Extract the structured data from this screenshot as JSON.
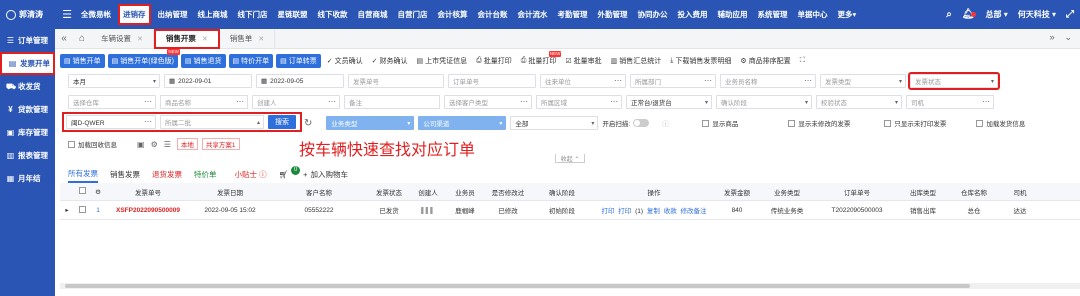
{
  "topbar": {
    "brand": "郭清涛",
    "nav": [
      "全微易帐",
      "进销存",
      "出纳管理",
      "线上商城",
      "线下门店",
      "星链联盟",
      "线下收款",
      "自营商城",
      "自营门店",
      "会计核算",
      "会计台账",
      "会计流水",
      "考勤管理",
      "外勤管理",
      "协同办公",
      "投入费用",
      "辅助应用",
      "系统管理",
      "单据中心",
      "更多"
    ],
    "active_nav": "进销存",
    "user_org": "总部",
    "user_company": "何天科技"
  },
  "sidebar": {
    "items": [
      {
        "label": "订单管理",
        "icon": "list-icon"
      },
      {
        "label": "发票开单",
        "icon": "doc-icon",
        "active": true
      },
      {
        "label": "收发货",
        "icon": "truck-icon"
      },
      {
        "label": "贷款管理",
        "icon": "money-icon"
      },
      {
        "label": "库存管理",
        "icon": "box-icon"
      },
      {
        "label": "报表管理",
        "icon": "report-icon"
      },
      {
        "label": "月年结",
        "icon": "calendar-icon"
      }
    ]
  },
  "tabstrip": {
    "tabs": [
      {
        "label": "车辆设置",
        "active": false
      },
      {
        "label": "销售开票",
        "active": true
      },
      {
        "label": "销售单",
        "active": false
      }
    ]
  },
  "toolbar": {
    "buttons": [
      "销售开单",
      "销售开单(绿色版)",
      "销售退货",
      "特价开单",
      "订单转票"
    ],
    "links": [
      "文员确认",
      "财务确认",
      "上市凭证信息",
      "批量打印",
      "批量打印",
      "批量审批",
      "销售汇总统计",
      "下载销售发票明细",
      "商品排序配置"
    ]
  },
  "filters": {
    "row1": {
      "period": "本月",
      "date_start": "2022-09-01",
      "date_end": "2022-09-05",
      "invoice_no": "发票单号",
      "order_no": "订单单号",
      "unit": "往来单位",
      "dept": "所属部门",
      "salesman": "业务员名称",
      "invoice_type": "发票类型",
      "invoice_status": "发票状态"
    },
    "row2": {
      "warehouse": "选择仓库",
      "product": "商品名称",
      "creator": "创建人",
      "remark": "备注",
      "customer_type": "选择客户类型",
      "region": "所属区域",
      "account": "正常台/退货台",
      "confirm_stage": "确认阶段",
      "review_status": "校验状态",
      "driver": "司机"
    },
    "row3": {
      "plate_value": "闽D-QWER",
      "plate_placeholder": "所属二批",
      "search_label": "搜索",
      "business_type": "业务类型",
      "company_channel": "公司渠道",
      "all": "全部",
      "scan_label": "开启扫描:",
      "check_products": "显示商品",
      "check_unmodified": "显示未修改的发票",
      "check_unprinted": "只显示未打印发票",
      "check_add": "加载发货信息"
    },
    "row4": {
      "check_reversed": "加载回收信息",
      "local": "本地",
      "share": "共享方案1"
    }
  },
  "annotation": "按车辆快速查找对应订单",
  "collapse_label": "收起",
  "list_tabs": {
    "tabs": [
      "所有发票",
      "销售发票",
      "退货发票",
      "特价单"
    ],
    "helper": "小贴士",
    "cart_count": "0",
    "cart_label": "加入购物车"
  },
  "table": {
    "headers": [
      "",
      "",
      "发票单号",
      "发票日期",
      "客户名称",
      "发票状态",
      "创建人",
      "业务员",
      "是否修改过",
      "确认阶段",
      "操作",
      "发票金额",
      "业务类型",
      "订单单号",
      "出库类型",
      "仓库名称",
      "司机"
    ],
    "rows": [
      {
        "index": "1",
        "invoice_no": "XSFP2022090500009",
        "date": "2022-09-05 15:02",
        "customer": "05552222",
        "status": "已发货",
        "creator": "▌▌▌",
        "salesman": "鹿帼峰",
        "modified": "已修改",
        "stage": "初始阶段",
        "ops": [
          "打印",
          "打印",
          "(1)",
          "复制",
          "收款",
          "修改备注"
        ],
        "amount": "840",
        "biz_type": "传统业务类",
        "order_no": "T2022090500003",
        "outbound": "销售出库",
        "warehouse": "总仓",
        "driver": "达达"
      }
    ]
  },
  "colors": {
    "primary": "#2a55b4",
    "accent": "#2f6fdc",
    "highlight": "#e02020"
  }
}
